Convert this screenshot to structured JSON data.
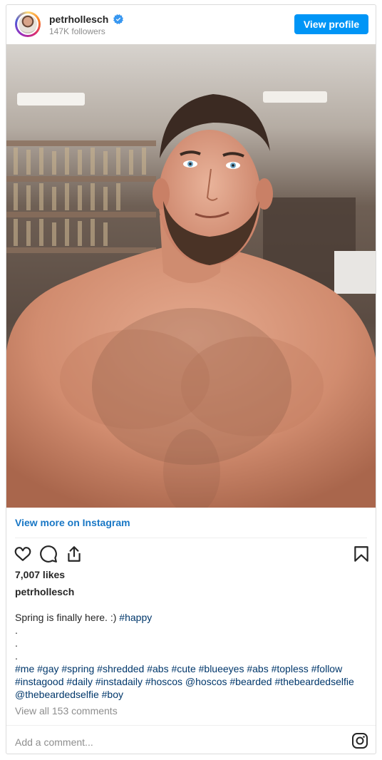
{
  "header": {
    "username": "petrhollesch",
    "followers": "147K followers",
    "view_profile_label": "View profile",
    "verified_icon": "verified-badge-icon"
  },
  "post": {
    "image_icon": "post-photo",
    "view_more_label": "View more on Instagram",
    "actions": {
      "like_icon": "heart-icon",
      "comment_icon": "comment-icon",
      "share_icon": "share-icon",
      "save_icon": "bookmark-icon"
    },
    "likes": "7,007 likes",
    "caption_user": "petrhollesch",
    "caption_text": "Spring is finally here. :) ",
    "caption_tag": "#happy",
    "dots": [
      ".",
      ".",
      "."
    ],
    "hashtag_lines": [
      "#me #gay #spring #shredded #abs #cute #blueeyes #abs #topless #follow",
      "#instagood #daily #instadaily #hoscos @hoscos #bearded #thebeardedselfie",
      "@thebeardedselfie #boy"
    ],
    "view_comments": "View all 153 comments",
    "add_comment_placeholder": "Add a comment...",
    "instagram_icon": "instagram-logo-icon"
  },
  "colors": {
    "accent": "#0095f6",
    "link": "#1877c5",
    "hashtag": "#00376b",
    "muted": "#8e8e8e"
  }
}
